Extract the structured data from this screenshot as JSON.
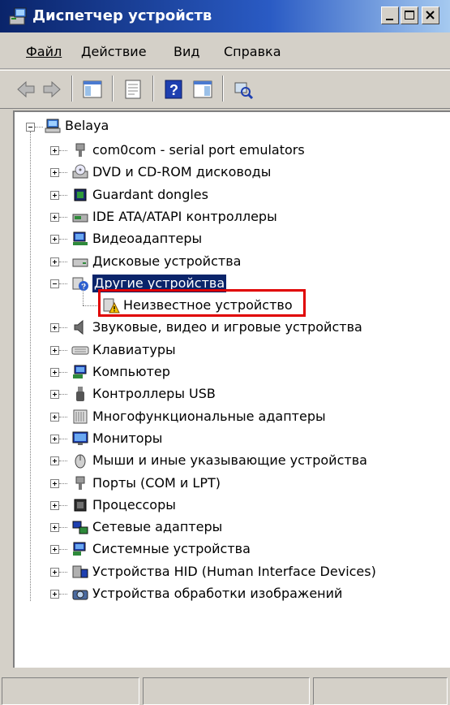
{
  "window": {
    "title": "Диспетчер устройств"
  },
  "menu": {
    "file": "Файл",
    "action": "Действие",
    "view": "Вид",
    "help": "Справка"
  },
  "tree": {
    "root": "Belaya",
    "items": [
      {
        "label": "com0com - serial port emulators",
        "icon": "port-icon"
      },
      {
        "label": "DVD и CD-ROM дисководы",
        "icon": "cd-drive-icon"
      },
      {
        "label": "Guardant dongles",
        "icon": "chip-icon"
      },
      {
        "label": "IDE ATA/ATAPI контроллеры",
        "icon": "ide-controller-icon"
      },
      {
        "label": "Видеоадаптеры",
        "icon": "display-adapter-icon"
      },
      {
        "label": "Дисковые устройства",
        "icon": "disk-drive-icon"
      },
      {
        "label": "Другие устройства",
        "icon": "unknown-device-icon"
      },
      {
        "label": "Неизвестное устройство",
        "icon": "warning-device-icon"
      },
      {
        "label": "Звуковые, видео и игровые устройства",
        "icon": "speaker-icon"
      },
      {
        "label": "Клавиатуры",
        "icon": "keyboard-icon"
      },
      {
        "label": "Компьютер",
        "icon": "computer-icon"
      },
      {
        "label": "Контроллеры USB",
        "icon": "usb-icon"
      },
      {
        "label": "Многофункциональные адаптеры",
        "icon": "multifunction-icon"
      },
      {
        "label": "Мониторы",
        "icon": "monitor-icon"
      },
      {
        "label": "Мыши и иные указывающие устройства",
        "icon": "mouse-icon"
      },
      {
        "label": "Порты (COM и LPT)",
        "icon": "port-icon"
      },
      {
        "label": "Процессоры",
        "icon": "cpu-icon"
      },
      {
        "label": "Сетевые адаптеры",
        "icon": "network-icon"
      },
      {
        "label": "Системные устройства",
        "icon": "system-icon"
      },
      {
        "label": "Устройства HID (Human Interface Devices)",
        "icon": "hid-icon"
      },
      {
        "label": "Устройства обработки изображений",
        "icon": "camera-icon"
      }
    ]
  },
  "colors": {
    "title_bar": "#0a246a",
    "selection": "#0a246a",
    "highlight_box": "#e00000"
  }
}
